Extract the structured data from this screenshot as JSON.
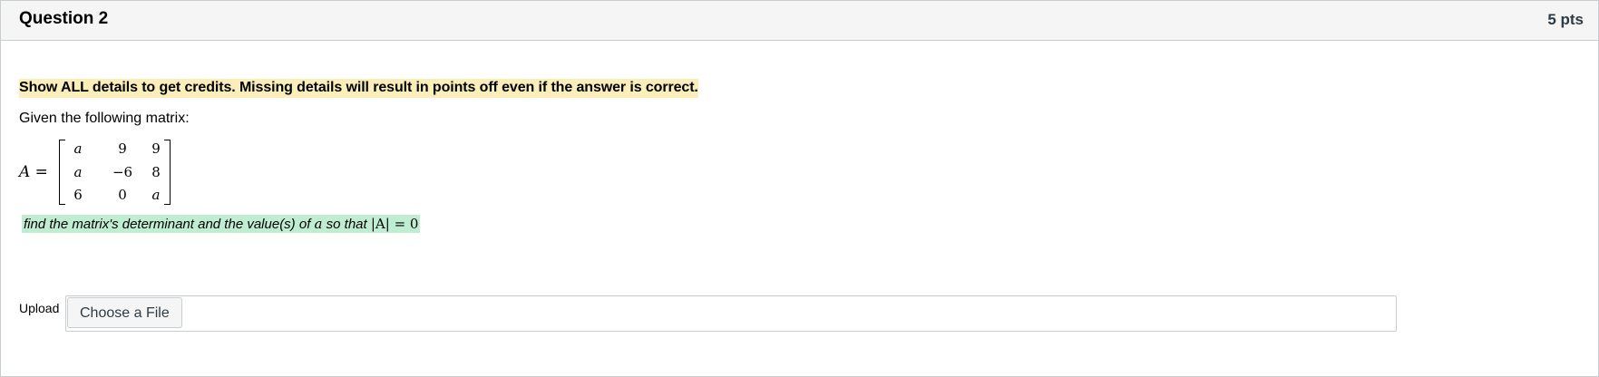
{
  "question": {
    "title": "Question 2",
    "points": "5 pts"
  },
  "body": {
    "instruction": "Show ALL details to get credits. Missing details will result in points off even if the answer is correct.",
    "given": "Given the following matrix:",
    "matrix_lhs": "A =",
    "matrix": [
      [
        "a",
        "9",
        "9"
      ],
      [
        "a",
        "−6",
        "8"
      ],
      [
        "6",
        "0",
        "a"
      ]
    ],
    "task_prefix": "find the matrix's determinant and the value(s) of ",
    "task_var": "a",
    "task_mid": " so that ",
    "task_expr": "|A| = 0"
  },
  "upload": {
    "label": "Upload",
    "button_label": "Choose a File"
  },
  "colors": {
    "instruction_highlight": "#fbeeb8",
    "task_highlight": "#bfedd2",
    "header_bg": "#f5f5f5",
    "border": "#c7cdd1"
  }
}
